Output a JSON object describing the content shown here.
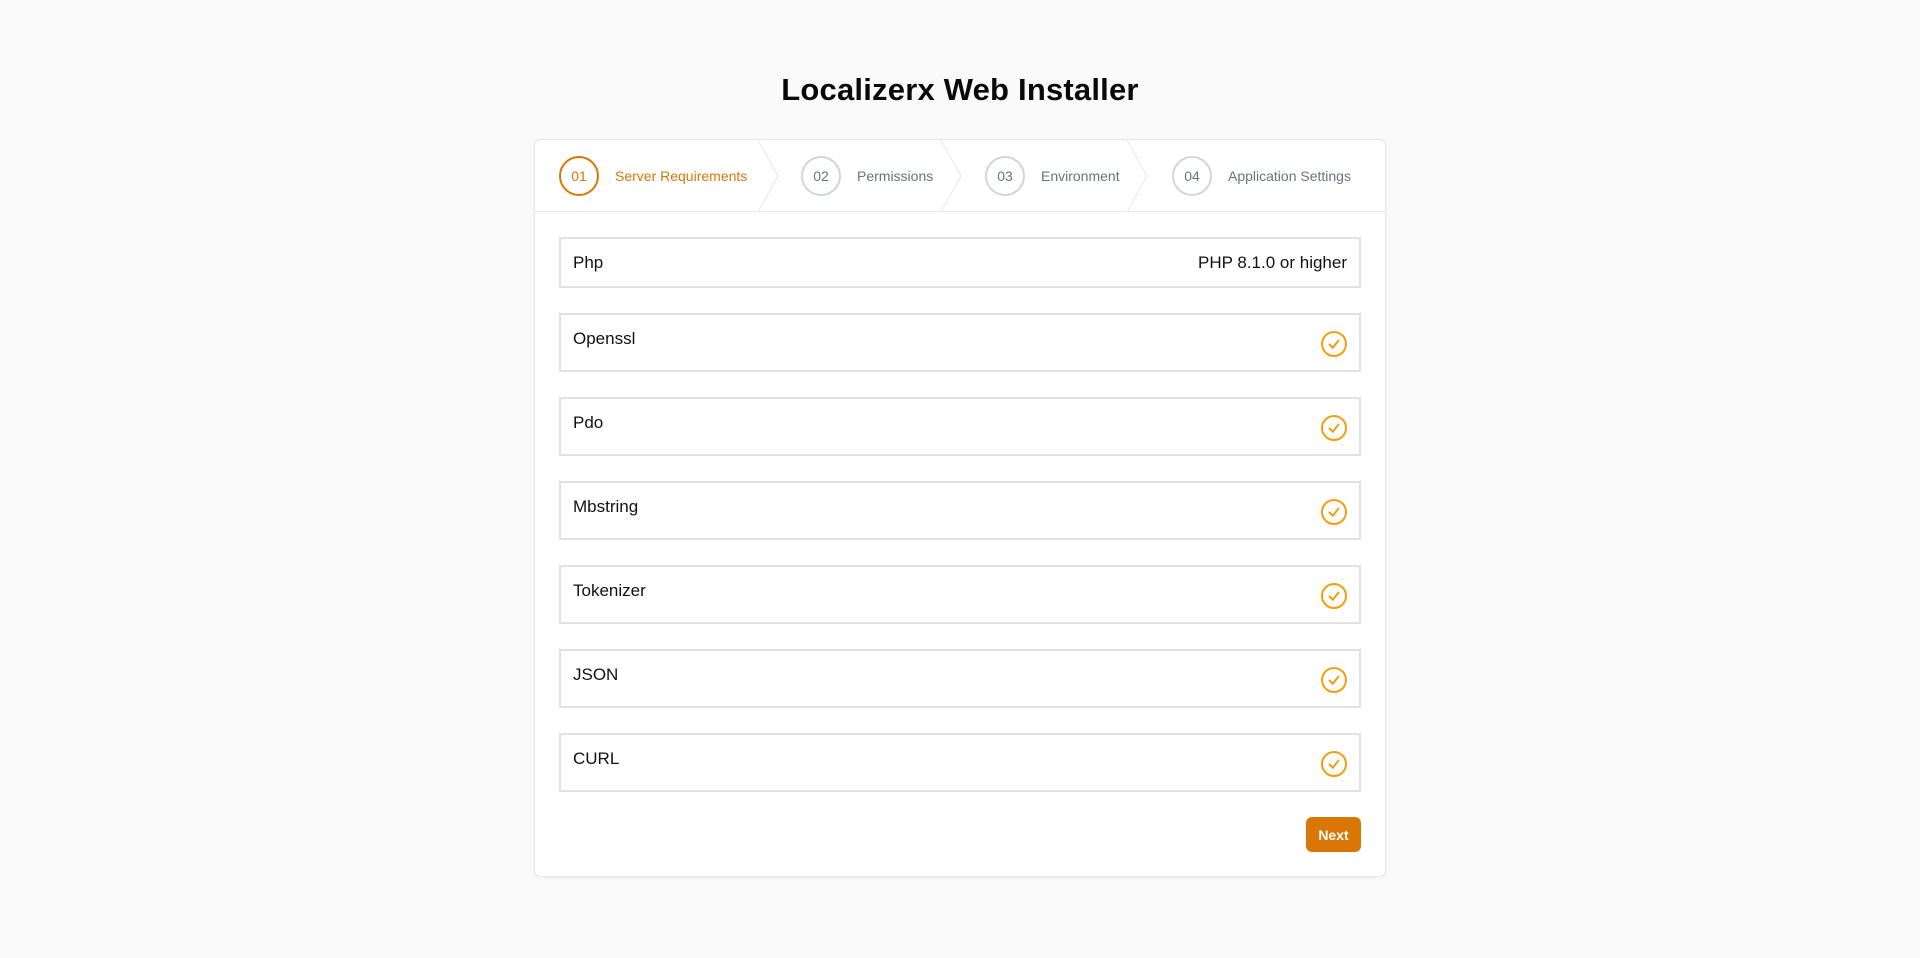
{
  "page": {
    "title": "Localizerx Web Installer"
  },
  "stepper": {
    "steps": [
      {
        "number": "01",
        "label": "Server Requirements",
        "active": true
      },
      {
        "number": "02",
        "label": "Permissions",
        "active": false
      },
      {
        "number": "03",
        "label": "Environment",
        "active": false
      },
      {
        "number": "04",
        "label": "Application Settings",
        "active": false
      }
    ]
  },
  "requirements": {
    "php": {
      "name": "Php",
      "value": "PHP 8.1.0 or higher"
    },
    "extensions": [
      {
        "name": "Openssl",
        "status": "check-icon"
      },
      {
        "name": "Pdo",
        "status": "check-icon"
      },
      {
        "name": "Mbstring",
        "status": "check-icon"
      },
      {
        "name": "Tokenizer",
        "status": "check-icon"
      },
      {
        "name": "JSON",
        "status": "check-icon"
      },
      {
        "name": "CURL",
        "status": "check-icon"
      }
    ]
  },
  "actions": {
    "next_label": "Next"
  },
  "colors": {
    "accent": "#d97706",
    "check": "#f59e0b",
    "inactive": "#6b7280",
    "border": "#e2e2e2",
    "background": "#fafafa"
  }
}
